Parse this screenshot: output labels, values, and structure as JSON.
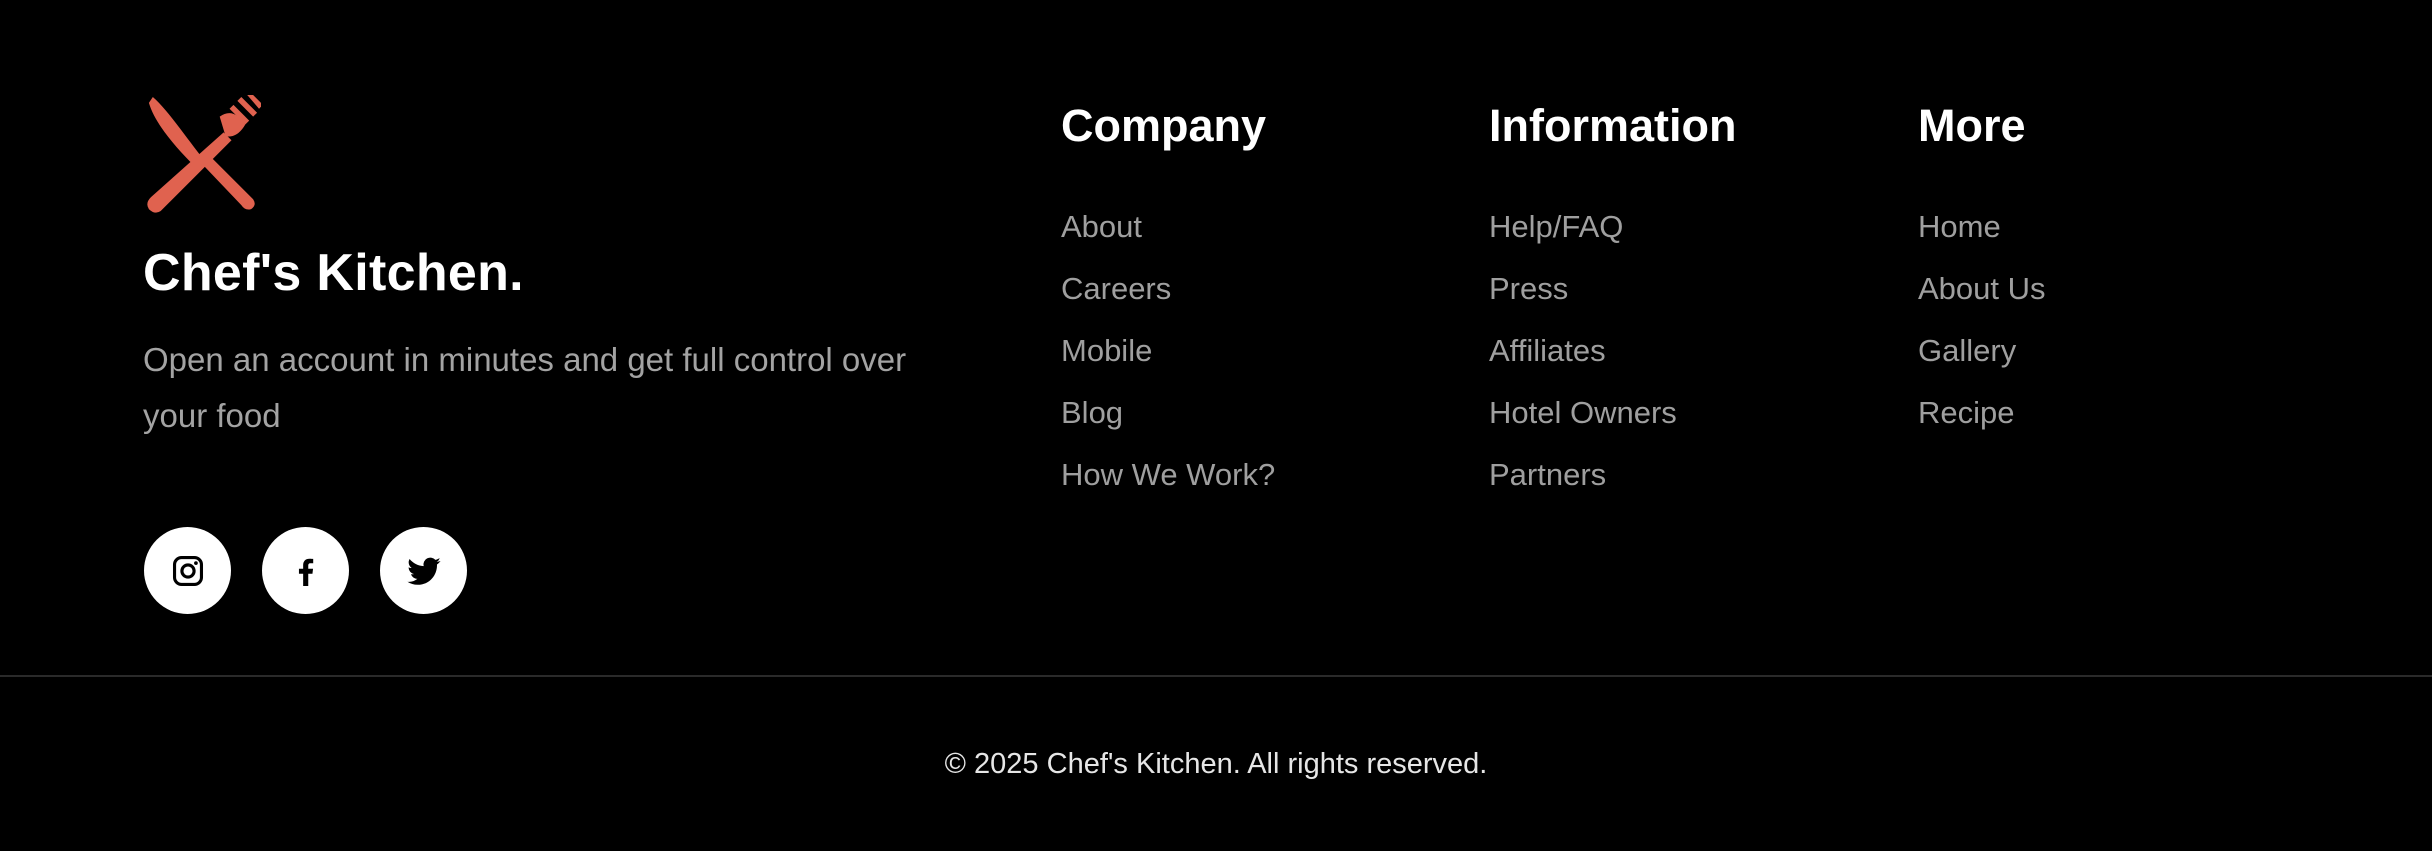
{
  "brand": {
    "name": "Chef's Kitchen.",
    "tagline": "Open an account in minutes and get full control over your food",
    "logo_icon": "knife-fork-crossed-icon",
    "accent_color": "#e0624f"
  },
  "socials": [
    {
      "name": "instagram",
      "icon": "instagram-icon"
    },
    {
      "name": "facebook",
      "icon": "facebook-icon"
    },
    {
      "name": "twitter",
      "icon": "twitter-icon"
    }
  ],
  "columns": {
    "company": {
      "title": "Company",
      "links": [
        "About",
        "Careers",
        "Mobile",
        "Blog",
        "How We Work?"
      ]
    },
    "information": {
      "title": "Information",
      "links": [
        "Help/FAQ",
        "Press",
        "Affiliates",
        "Hotel Owners",
        "Partners"
      ]
    },
    "more": {
      "title": "More",
      "links": [
        "Home",
        "About Us",
        "Gallery",
        "Recipe"
      ]
    }
  },
  "copyright": "© 2025 Chef's Kitchen. All rights reserved."
}
